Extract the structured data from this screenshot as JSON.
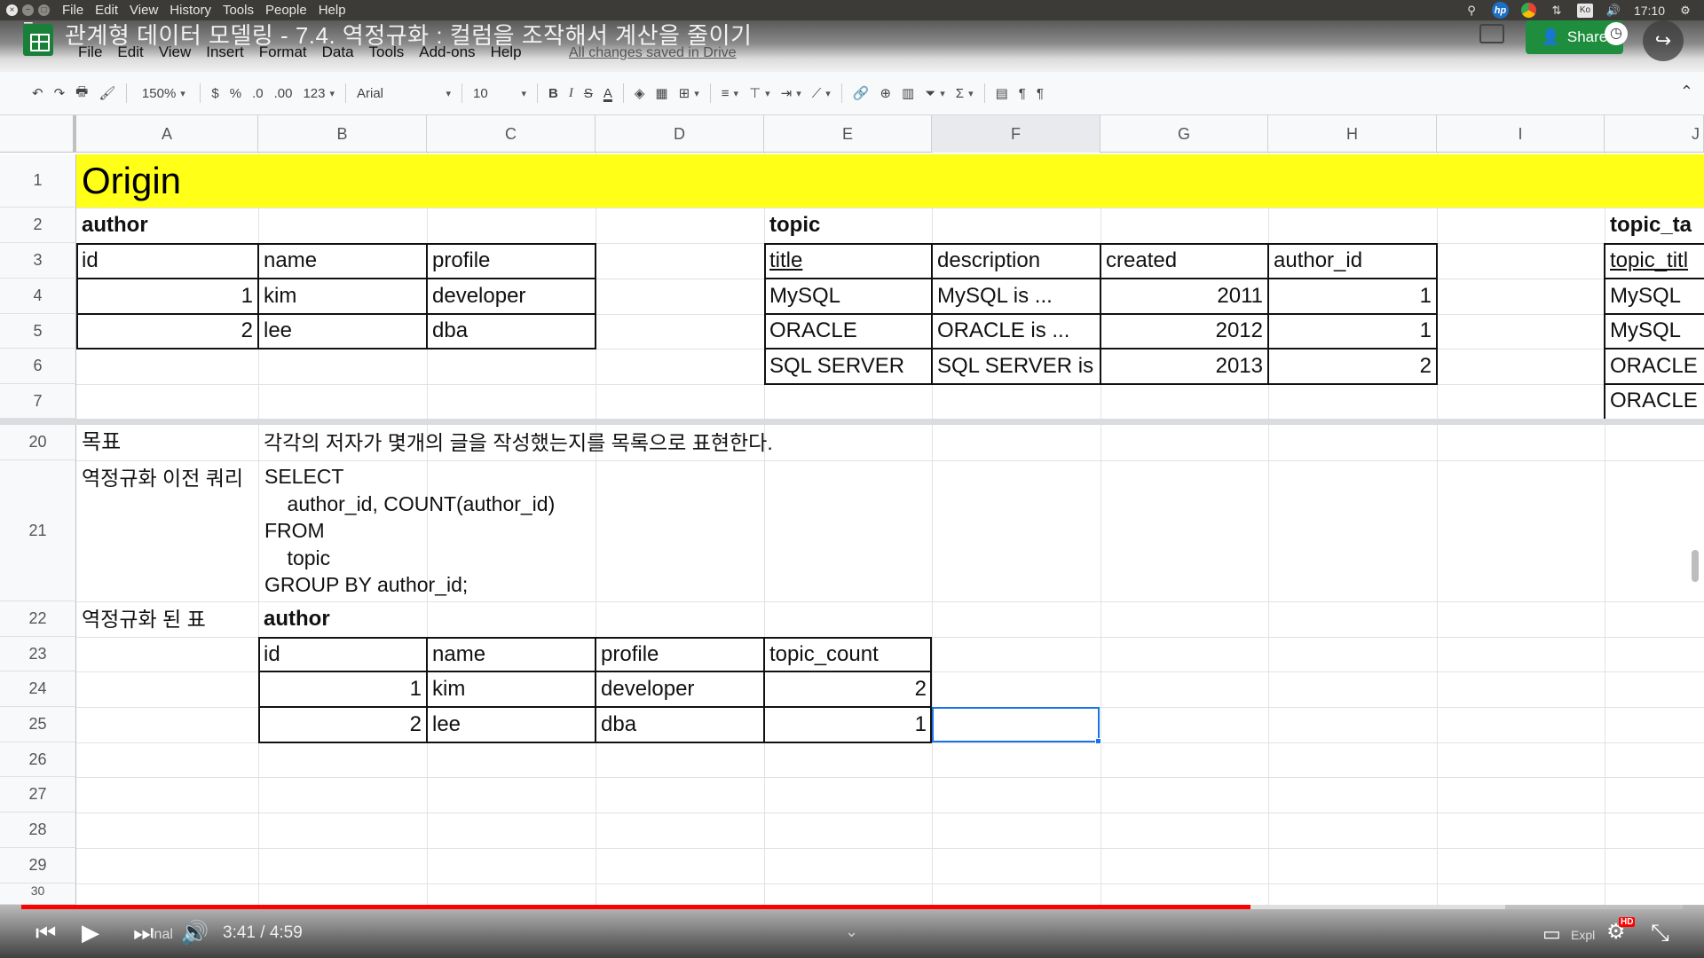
{
  "os": {
    "menus": [
      "File",
      "Edit",
      "View",
      "History",
      "Tools",
      "People",
      "Help"
    ],
    "clock": "17:10",
    "ime": "Ko"
  },
  "doc": {
    "title": "관계형 데이터 모델링 - 7.4. 역정규화 : 컬럼을 조작해서 계산을 줄이기",
    "menus": [
      "File",
      "Edit",
      "View",
      "Insert",
      "Format",
      "Data",
      "Tools",
      "Add-ons",
      "Help"
    ],
    "saved_status": "All changes saved in Drive",
    "share_label": "Share"
  },
  "toolbar": {
    "zoom": "150%",
    "currency": "$",
    "percent": "%",
    "dec_less": ".0",
    "dec_more": ".00",
    "more_formats": "123",
    "font": "Arial",
    "size": "10",
    "bold": "B",
    "italic": "I",
    "strike": "S",
    "text_color": "A"
  },
  "columns": [
    "A",
    "B",
    "C",
    "D",
    "E",
    "F",
    "G",
    "H",
    "I",
    "J"
  ],
  "rows": [
    "1",
    "2",
    "3",
    "4",
    "5",
    "6",
    "7",
    "20",
    "21",
    "22",
    "23",
    "24",
    "25",
    "26",
    "27",
    "28",
    "29",
    "30"
  ],
  "origin": {
    "title": "Origin"
  },
  "author_table": {
    "caption": "author",
    "headers": [
      "id",
      "name",
      "profile"
    ],
    "rows": [
      [
        "1",
        "kim",
        "developer"
      ],
      [
        "2",
        "lee",
        "dba"
      ]
    ]
  },
  "topic_table": {
    "caption": "topic",
    "headers": [
      "title",
      "description",
      "created",
      "author_id"
    ],
    "rows": [
      [
        "MySQL",
        "MySQL is ...",
        "2011",
        "1"
      ],
      [
        "ORACLE",
        "ORACLE is ...",
        "2012",
        "1"
      ],
      [
        "SQL SERVER",
        "SQL SERVER is",
        "2013",
        "2"
      ]
    ]
  },
  "topic_tag_table": {
    "caption": "topic_ta",
    "header": "topic_titl",
    "rows": [
      "MySQL",
      "MySQL",
      "ORACLE",
      "ORACLE"
    ]
  },
  "goal": {
    "label": "목표",
    "text": "각각의 저자가 몇개의 글을 작성했는지를 목록으로 표현한다."
  },
  "query": {
    "label": "역정규화 이전 쿼리",
    "lines": [
      "SELECT",
      "    author_id, COUNT(author_id)",
      "FROM",
      "    topic",
      "GROUP BY author_id;"
    ]
  },
  "denorm": {
    "label": "역정규화 된 표",
    "caption": "author",
    "headers": [
      "id",
      "name",
      "profile",
      "topic_count"
    ],
    "rows": [
      [
        "1",
        "kim",
        "developer",
        "2"
      ],
      [
        "2",
        "lee",
        "dba",
        "1"
      ]
    ]
  },
  "player": {
    "time": "3:41 / 4:59",
    "overlay": "inal",
    "explore": "Expl",
    "hd": "HD",
    "played_fraction": 0.74
  }
}
